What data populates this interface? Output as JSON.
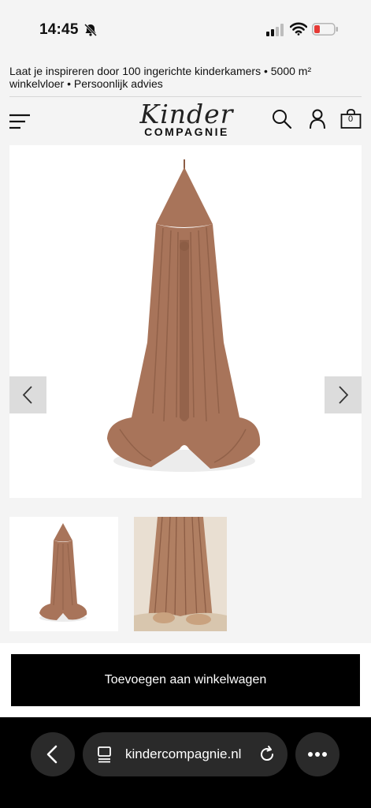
{
  "status": {
    "time": "14:45"
  },
  "promo": {
    "text": "Laat je inspireren door 100 ingerichte kinderkamers • 5000 m² winkelvloer • Persoonlijk advies"
  },
  "header": {
    "logo_script": "Kinder",
    "logo_sub": "COMPAGNIE",
    "cart_count": "0"
  },
  "product": {
    "add_to_cart_label": "Toevoegen aan winkelwagen"
  },
  "browser": {
    "url": "kindercompagnie.nl"
  },
  "colors": {
    "canopy": "#a8745a",
    "canopy_dark": "#8c5d45",
    "cta_bg": "#000000",
    "battery_low": "#e53935"
  },
  "icons": [
    "bell-slash-icon",
    "signal-icon",
    "wifi-icon",
    "battery-icon",
    "menu-icon",
    "search-icon",
    "account-icon",
    "cart-icon",
    "chevron-left-icon",
    "chevron-right-icon",
    "page-icon",
    "reload-icon",
    "more-icon"
  ]
}
